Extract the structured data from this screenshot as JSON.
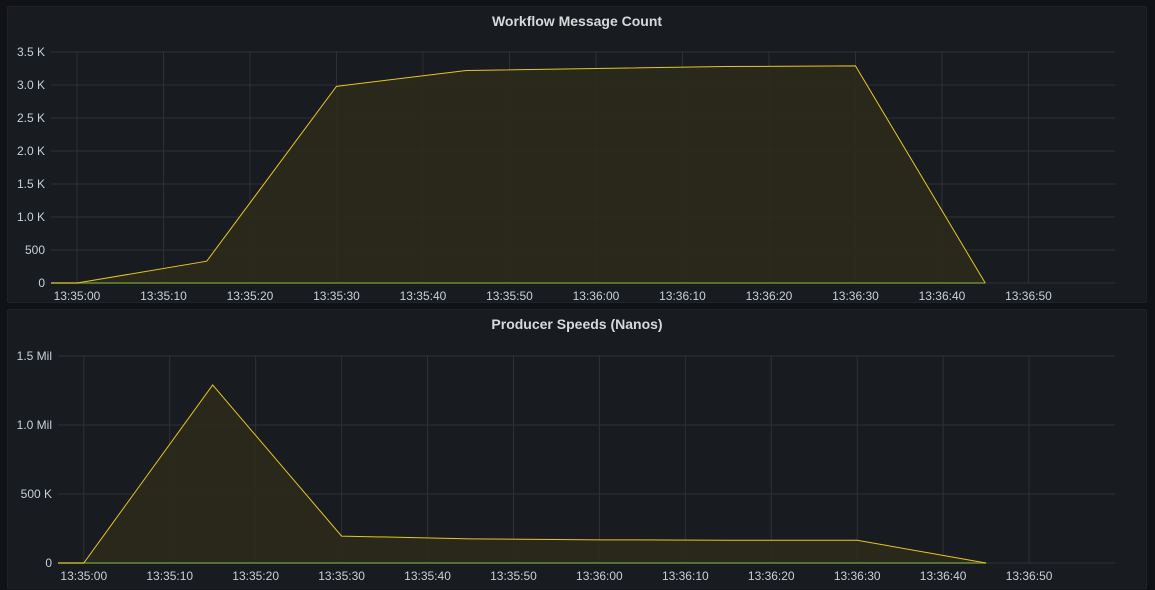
{
  "dashboard": {
    "colors": {
      "background": "#111217",
      "panel": "#181b1f",
      "grid": "#2f3136",
      "series_line": "#e5c622",
      "series_fill": "#2c2a19",
      "baseline": "#6a8a3a",
      "text": "#c7d0d9"
    }
  },
  "chart_data": [
    {
      "type": "area",
      "title": "Workflow Message Count",
      "xlabel": "",
      "ylabel": "",
      "x_ticks": [
        "13:35:00",
        "13:35:10",
        "13:35:20",
        "13:35:30",
        "13:35:40",
        "13:35:50",
        "13:36:00",
        "13:36:10",
        "13:36:20",
        "13:36:30",
        "13:36:40",
        "13:36:50"
      ],
      "y_ticks": [
        {
          "value": 0,
          "label": "0"
        },
        {
          "value": 500,
          "label": "500"
        },
        {
          "value": 1000,
          "label": "1.0 K"
        },
        {
          "value": 1500,
          "label": "1.5 K"
        },
        {
          "value": 2000,
          "label": "2.0 K"
        },
        {
          "value": 2500,
          "label": "2.5 K"
        },
        {
          "value": 3000,
          "label": "3.0 K"
        },
        {
          "value": 3500,
          "label": "3.5 K"
        }
      ],
      "xlim": [
        "13:34:57",
        "13:37:00"
      ],
      "ylim": [
        0,
        3500
      ],
      "grid": true,
      "legend": "none",
      "series": [
        {
          "x": [
            "13:34:57",
            "13:35:00",
            "13:35:15",
            "13:35:30",
            "13:35:45",
            "13:36:00",
            "13:36:15",
            "13:36:30",
            "13:36:45"
          ],
          "values": [
            0,
            0,
            330,
            2980,
            3220,
            3250,
            3280,
            3290,
            0
          ]
        }
      ]
    },
    {
      "type": "area",
      "title": "Producer Speeds (Nanos)",
      "xlabel": "",
      "ylabel": "",
      "x_ticks": [
        "13:35:00",
        "13:35:10",
        "13:35:20",
        "13:35:30",
        "13:35:40",
        "13:35:50",
        "13:36:00",
        "13:36:10",
        "13:36:20",
        "13:36:30",
        "13:36:40",
        "13:36:50"
      ],
      "y_ticks": [
        {
          "value": 0,
          "label": "0"
        },
        {
          "value": 500000,
          "label": "500 K"
        },
        {
          "value": 1000000,
          "label": "1.0 Mil"
        },
        {
          "value": 1500000,
          "label": "1.5 Mil"
        }
      ],
      "xlim": [
        "13:34:57",
        "13:37:00"
      ],
      "ylim": [
        0,
        1500000
      ],
      "grid": true,
      "legend": "none",
      "series": [
        {
          "x": [
            "13:34:57",
            "13:35:00",
            "13:35:15",
            "13:35:30",
            "13:35:45",
            "13:36:00",
            "13:36:15",
            "13:36:30",
            "13:36:45"
          ],
          "values": [
            0,
            0,
            1290000,
            195000,
            175000,
            168000,
            165000,
            165000,
            0
          ]
        }
      ]
    }
  ]
}
